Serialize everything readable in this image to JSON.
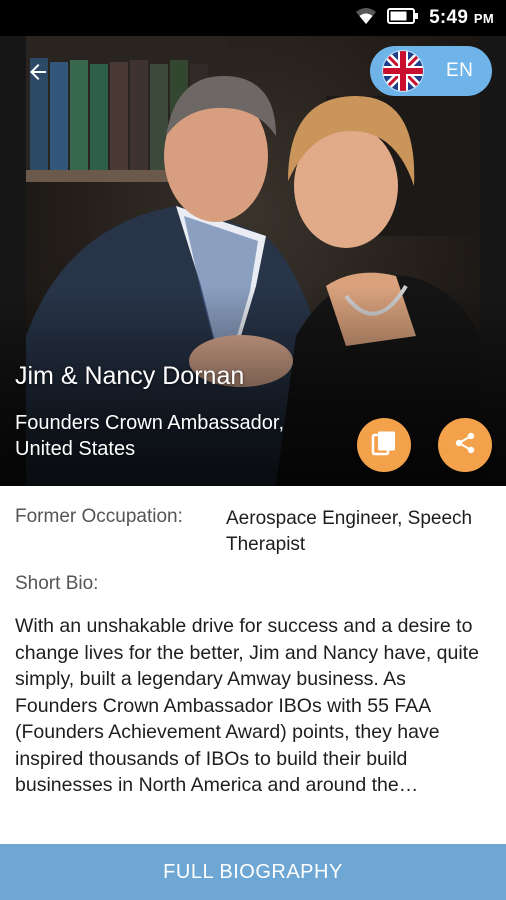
{
  "status_bar": {
    "time": "5:49",
    "ampm": "PM",
    "icons": [
      "wifi-icon",
      "battery-icon"
    ]
  },
  "hero": {
    "name": "Jim & Nancy Dornan",
    "title": "Founders Crown Ambassador, United States",
    "language": {
      "code": "EN",
      "flag": "uk-flag-icon"
    },
    "actions": [
      "book-icon",
      "share-icon"
    ]
  },
  "details": {
    "occupation_label": "Former Occupation:",
    "occupation_value": "Aerospace Engineer, Speech Therapist",
    "bio_label": "Short Bio:",
    "bio_text": "With an unshakable drive for success and a desire to change lives for the better, Jim and Nancy have, quite simply, built a legendary Amway business.  As Founders Crown Ambassador IBOs with 55 FAA (Founders Achievement Award) points, they have inspired thousands of IBOs to build their build businesses in North America and around the…"
  },
  "footer": {
    "button_label": "FULL BIOGRAPHY"
  },
  "colors": {
    "accent_orange": "#f3a14a",
    "footer_blue": "#6ea6d4",
    "lang_pill_blue": "#6fb4e8"
  }
}
